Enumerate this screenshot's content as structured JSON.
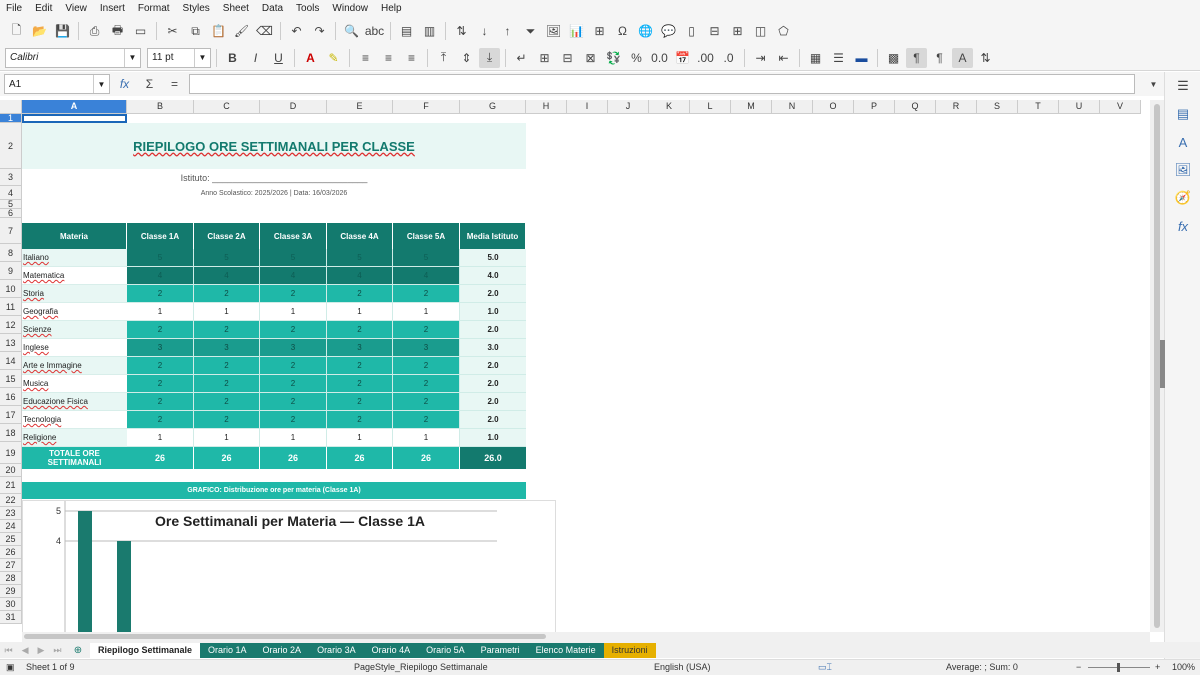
{
  "menu": [
    "File",
    "Edit",
    "View",
    "Insert",
    "Format",
    "Styles",
    "Sheet",
    "Data",
    "Tools",
    "Window",
    "Help"
  ],
  "toolbar": {
    "font_name": "Calibri",
    "font_size": "11 pt"
  },
  "formula_bar": {
    "name_box": "A1",
    "value": ""
  },
  "columns": [
    "A",
    "B",
    "C",
    "D",
    "E",
    "F",
    "G",
    "H",
    "I",
    "J",
    "K",
    "L",
    "M",
    "N",
    "O",
    "P",
    "Q",
    "R",
    "S",
    "T",
    "U",
    "V"
  ],
  "sheet": {
    "title": "RIEPILOGO ORE SETTIMANALI PER CLASSE",
    "istituto": "Istituto: _______________________________",
    "anno": "Anno Scolastico: 2025/2026  |  Data: 16/03/2026",
    "headers": [
      "Materia",
      "Classe 1A",
      "Classe 2A",
      "Classe 3A",
      "Classe 4A",
      "Classe 5A",
      "Media Istituto"
    ],
    "rows": [
      {
        "materia": "Italiano",
        "v": [
          "5",
          "5",
          "5",
          "5",
          "5"
        ],
        "media": "5.0"
      },
      {
        "materia": "Matematica",
        "v": [
          "4",
          "4",
          "4",
          "4",
          "4"
        ],
        "media": "4.0"
      },
      {
        "materia": "Storia",
        "v": [
          "2",
          "2",
          "2",
          "2",
          "2"
        ],
        "media": "2.0"
      },
      {
        "materia": "Geografia",
        "v": [
          "1",
          "1",
          "1",
          "1",
          "1"
        ],
        "media": "1.0"
      },
      {
        "materia": "Scienze",
        "v": [
          "2",
          "2",
          "2",
          "2",
          "2"
        ],
        "media": "2.0"
      },
      {
        "materia": "Inglese",
        "v": [
          "3",
          "3",
          "3",
          "3",
          "3"
        ],
        "media": "3.0"
      },
      {
        "materia": "Arte e Immagine",
        "v": [
          "2",
          "2",
          "2",
          "2",
          "2"
        ],
        "media": "2.0"
      },
      {
        "materia": "Musica",
        "v": [
          "2",
          "2",
          "2",
          "2",
          "2"
        ],
        "media": "2.0"
      },
      {
        "materia": "Educazione Fisica",
        "v": [
          "2",
          "2",
          "2",
          "2",
          "2"
        ],
        "media": "2.0"
      },
      {
        "materia": "Tecnologia",
        "v": [
          "2",
          "2",
          "2",
          "2",
          "2"
        ],
        "media": "2.0"
      },
      {
        "materia": "Religione",
        "v": [
          "1",
          "1",
          "1",
          "1",
          "1"
        ],
        "media": "1.0"
      }
    ],
    "totals": {
      "label": "TOTALE ORE SETTIMANALI",
      "v": [
        "26",
        "26",
        "26",
        "26",
        "26"
      ],
      "media": "26.0"
    },
    "grafico_label": "GRAFICO: Distribuzione ore per materia (Classe 1A)"
  },
  "chart_data": {
    "type": "bar",
    "title": "Ore Settimanali per Materia — Classe 1A",
    "yticks": [
      "6",
      "5",
      "4"
    ],
    "visible_values": [
      5,
      4
    ],
    "ylim": [
      0,
      6
    ],
    "color": "#1a7a6e"
  },
  "tabs": [
    "Riepilogo Settimanale",
    "Orario 1A",
    "Orario 2A",
    "Orario 3A",
    "Orario 4A",
    "Orario 5A",
    "Parametri",
    "Elenco Materie",
    "Istruzioni"
  ],
  "status": {
    "sheet": "Sheet 1 of 9",
    "pagestyle": "PageStyle_Riepilogo Settimanale",
    "lang": "English (USA)",
    "sum": "Average: ; Sum: 0",
    "zoom": "100%"
  },
  "colors": {
    "dark_teal": "#137a6e",
    "mid_teal": "#1fb8a8",
    "light_teal": "#e8f7f4",
    "header_teal": "#1a7a6e"
  }
}
